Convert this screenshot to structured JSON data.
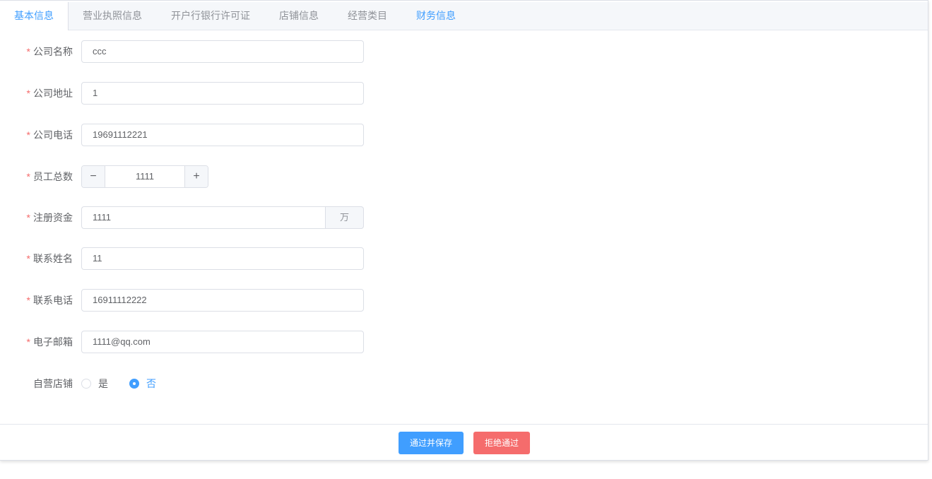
{
  "tabs": [
    "基本信息",
    "营业执照信息",
    "开户行银行许可证",
    "店铺信息",
    "经营类目",
    "财务信息"
  ],
  "form": {
    "required_mark": "*",
    "company_name": {
      "label": "公司名称",
      "value": "ccc"
    },
    "company_address": {
      "label": "公司地址",
      "value": "1"
    },
    "company_phone": {
      "label": "公司电话",
      "value": "19691112221"
    },
    "employee_count": {
      "label": "员工总数",
      "value": "1111",
      "minus": "−",
      "plus": "+"
    },
    "registered_capital": {
      "label": "注册资金",
      "value": "1111",
      "unit": "万"
    },
    "contact_name": {
      "label": "联系姓名",
      "value": "11"
    },
    "contact_phone": {
      "label": "联系电话",
      "value": "16911112222"
    },
    "email": {
      "label": "电子邮箱",
      "value": "1111@qq.com"
    },
    "self_operated": {
      "label": "自营店铺",
      "options": [
        "是",
        "否"
      ],
      "selected": "否"
    }
  },
  "actions": {
    "approve": "通过并保存",
    "reject": "拒绝通过"
  },
  "colors": {
    "primary": "#409eff",
    "danger": "#f56c6c",
    "required": "#f56c6c"
  }
}
